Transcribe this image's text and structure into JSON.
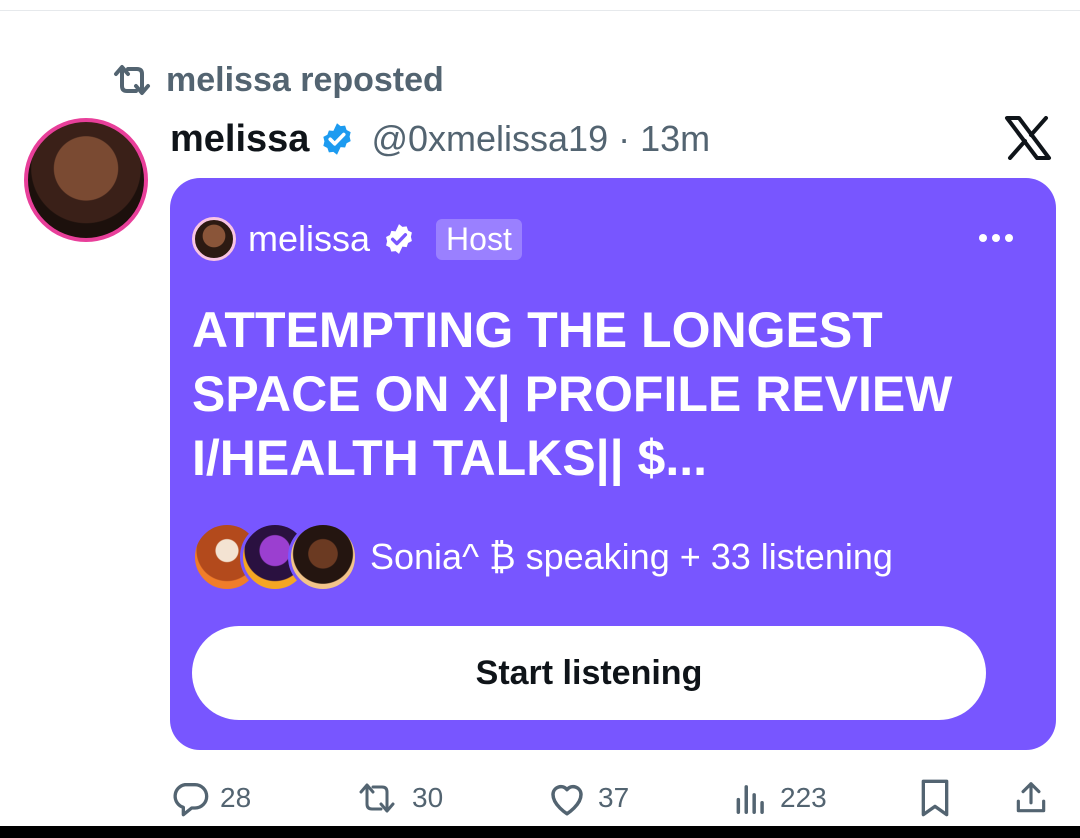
{
  "repost": {
    "label": "melissa reposted",
    "icon": "repost-icon"
  },
  "tweet": {
    "author_name": "melissa",
    "handle": "@0xmelissa19",
    "separator": "·",
    "time": "13m",
    "verified_icon": "verified-badge-icon"
  },
  "space": {
    "host_name": "melissa",
    "host_badge": "Host",
    "title": "ATTEMPTING THE LONGEST SPACE ON X| PROFILE REVIEW I/HEALTH TALKS|| $...",
    "speaking_text": "Sonia^ ₿ speaking + 33 listening",
    "button_label": "Start listening",
    "card_color": "#7856ff"
  },
  "actions": {
    "replies": "28",
    "reposts": "30",
    "likes": "37",
    "views": "223"
  },
  "colors": {
    "accent": "#7856ff",
    "verified": "#1d9bf0",
    "muted": "#536471"
  }
}
